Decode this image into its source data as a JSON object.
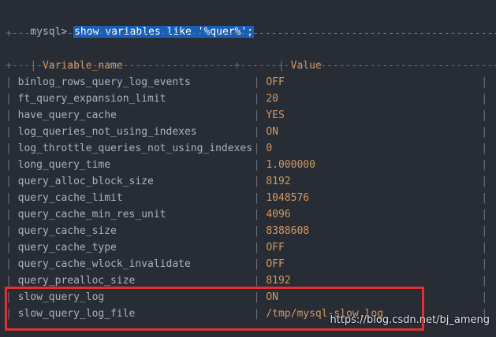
{
  "terminal": {
    "prompt": "mysql>",
    "command": "show variables like '%quer%';",
    "border": "+------------------------------------+-------------------------------------------+",
    "headers": [
      "Variable_name",
      "Value"
    ],
    "rows": [
      {
        "name": "binlog_rows_query_log_events",
        "value": "OFF"
      },
      {
        "name": "ft_query_expansion_limit",
        "value": "20"
      },
      {
        "name": "have_query_cache",
        "value": "YES"
      },
      {
        "name": "log_queries_not_using_indexes",
        "value": "ON"
      },
      {
        "name": "log_throttle_queries_not_using_indexes",
        "value": "0"
      },
      {
        "name": "long_query_time",
        "value": "1.000000"
      },
      {
        "name": "query_alloc_block_size",
        "value": "8192"
      },
      {
        "name": "query_cache_limit",
        "value": "1048576"
      },
      {
        "name": "query_cache_min_res_unit",
        "value": "4096"
      },
      {
        "name": "query_cache_size",
        "value": "8388608"
      },
      {
        "name": "query_cache_type",
        "value": "OFF"
      },
      {
        "name": "query_cache_wlock_invalidate",
        "value": "OFF"
      },
      {
        "name": "query_prealloc_size",
        "value": "8192"
      },
      {
        "name": "slow_query_log",
        "value": "ON"
      },
      {
        "name": "slow_query_log_file",
        "value": "/tmp/mysql-slow.log"
      }
    ]
  },
  "watermark": "https://blog.csdn.net/bj_ameng",
  "colors": {
    "background": "#282c34",
    "selection": "#1a5fb4",
    "value": "#d19a66",
    "highlight": "#e03131"
  }
}
